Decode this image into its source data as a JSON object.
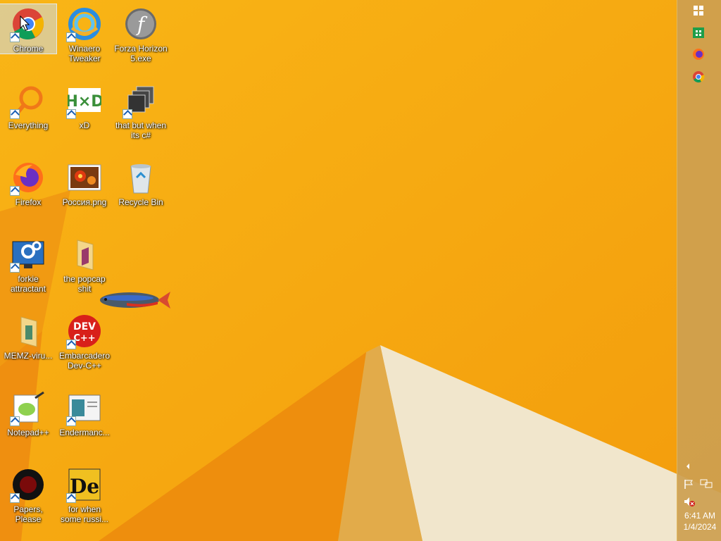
{
  "desktop": {
    "icons": [
      {
        "label": "Chrome",
        "icon": "chrome-icon"
      },
      {
        "label": "Winaero Tweaker",
        "icon": "winaero-icon"
      },
      {
        "label": "Forza Horizon 5.exe",
        "icon": "flash-icon"
      },
      {
        "label": "Everything",
        "icon": "everything-search-icon"
      },
      {
        "label": "xD",
        "icon": "hxd-icon"
      },
      {
        "label": "that but when its c#",
        "icon": "stacked-windows-icon"
      },
      {
        "label": "Firefox",
        "icon": "firefox-icon"
      },
      {
        "label": "Россия.png",
        "icon": "flower-image-icon"
      },
      {
        "label": "Recycle Bin",
        "icon": "recycle-bin-icon"
      },
      {
        "label": "forkie attractant",
        "icon": "settings-monitor-icon"
      },
      {
        "label": "the popcap shit",
        "icon": "folder-icon"
      },
      {
        "label": "MEMZ-viru...",
        "icon": "folder-icon"
      },
      {
        "label": "Embarcadero Dev-C++",
        "icon": "devcpp-icon"
      },
      {
        "label": "Notepad++",
        "icon": "notepadpp-icon"
      },
      {
        "label": "Endermanc...",
        "icon": "window-icon"
      },
      {
        "label": "Papers, Please",
        "icon": "papers-please-icon"
      },
      {
        "label": "for when some russi...",
        "icon": "de-icon"
      }
    ],
    "selected": "Chrome"
  },
  "taskbar": {
    "buttons": [
      "start-icon",
      "store-icon",
      "firefox-icon",
      "chrome-icon"
    ],
    "tray": [
      "chevron-left-icon",
      "flag-icon",
      "network-icon",
      "volume-muted-icon"
    ],
    "time": "6:41 AM",
    "date": "1/4/2024"
  },
  "colors": {
    "wallpaper": "#f7a710",
    "taskbar": "#cda050"
  }
}
